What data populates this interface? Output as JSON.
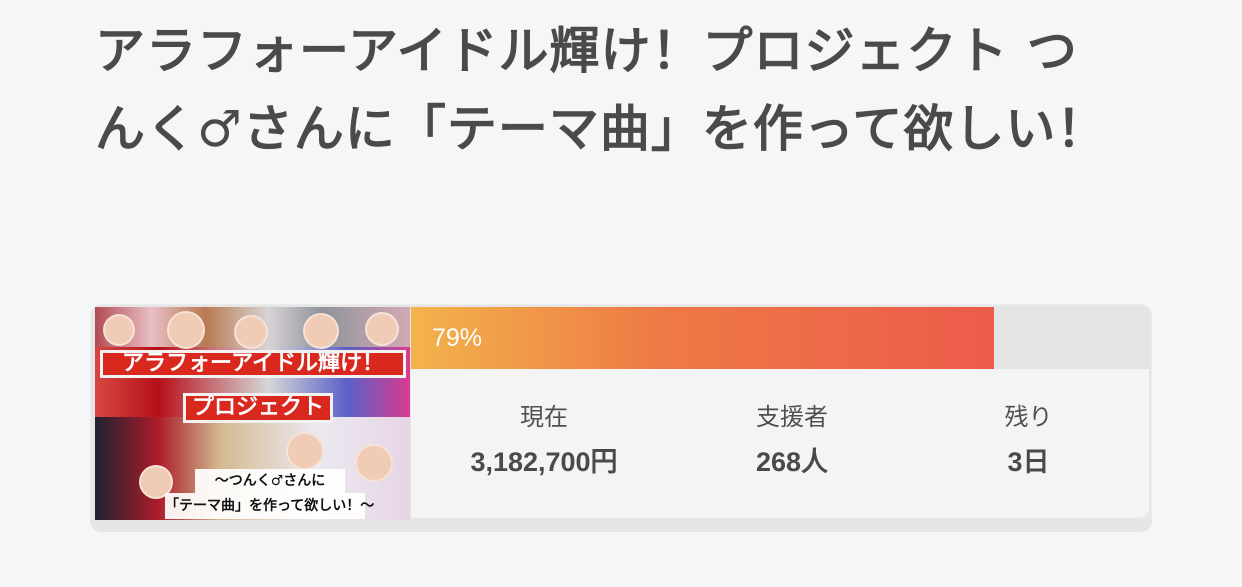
{
  "page": {
    "title": "アラフォーアイドル輝け！プロジェクト つんく♂さんに「テーマ曲」を作って欲しい！"
  },
  "card": {
    "thumbnail": {
      "title_line_1": "アラフォーアイドル輝け！",
      "title_line_2": "プロジェクト",
      "subtitle_line_1": "〜つんく♂さんに",
      "subtitle_line_2": "「テーマ曲」を作って欲しい！〜"
    },
    "progress": {
      "percent_text": "79%",
      "percent": 79,
      "fill_color_start": "#f3b34c",
      "fill_color_end": "#ec5b4b"
    },
    "stats": {
      "current_label": "現在",
      "current_value": "3,182,700円",
      "backers_label": "支援者",
      "backers_value": "268人",
      "remaining_label": "残り",
      "remaining_value": "3日"
    }
  }
}
